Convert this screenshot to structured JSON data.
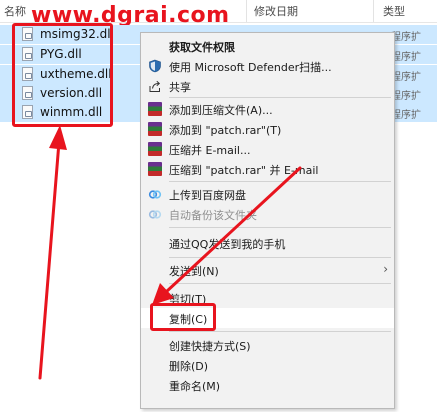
{
  "watermark": "www.dgrai.com",
  "columns": {
    "name": "名称",
    "date": "修改日期",
    "type": "类型"
  },
  "files": [
    {
      "name": "msimg32.dll",
      "type": "用程序扩"
    },
    {
      "name": "PYG.dll",
      "type": "用程序扩"
    },
    {
      "name": "uxtheme.dll",
      "type": "用程序扩"
    },
    {
      "name": "version.dll",
      "type": "用程序扩"
    },
    {
      "name": "winmm.dll",
      "type": "用程序扩"
    }
  ],
  "menu": {
    "items": [
      {
        "label": "获取文件权限",
        "icon": "none"
      },
      {
        "label": "使用 Microsoft Defender扫描...",
        "icon": "defender-shield-icon"
      },
      {
        "label": "共享",
        "icon": "share-icon"
      },
      {
        "label": "添加到压缩文件(A)...",
        "icon": "winrar-icon"
      },
      {
        "label": "添加到 \"patch.rar\"(T)",
        "icon": "winrar-icon"
      },
      {
        "label": "压缩并 E-mail...",
        "icon": "winrar-icon"
      },
      {
        "label": "压缩到 \"patch.rar\" 并 E-mail",
        "icon": "winrar-icon"
      },
      {
        "label": "上传到百度网盘",
        "icon": "baidu-netdisk-icon"
      },
      {
        "label": "自动备份该文件夹",
        "icon": "baidu-netdisk-icon"
      },
      {
        "label": "通过QQ发送到我的手机",
        "icon": "none"
      },
      {
        "label": "发送到(N)",
        "icon": "chevron-right-icon"
      },
      {
        "label": "剪切(T)",
        "icon": "none"
      },
      {
        "label": "复制(C)",
        "icon": "none"
      },
      {
        "label": "创建快捷方式(S)",
        "icon": "none"
      },
      {
        "label": "删除(D)",
        "icon": "none"
      },
      {
        "label": "重命名(M)",
        "icon": "none"
      }
    ]
  },
  "colors": {
    "selection": "#cce8ff",
    "annotation": "#e8141e",
    "menu_bg": "#f2f2f2"
  }
}
